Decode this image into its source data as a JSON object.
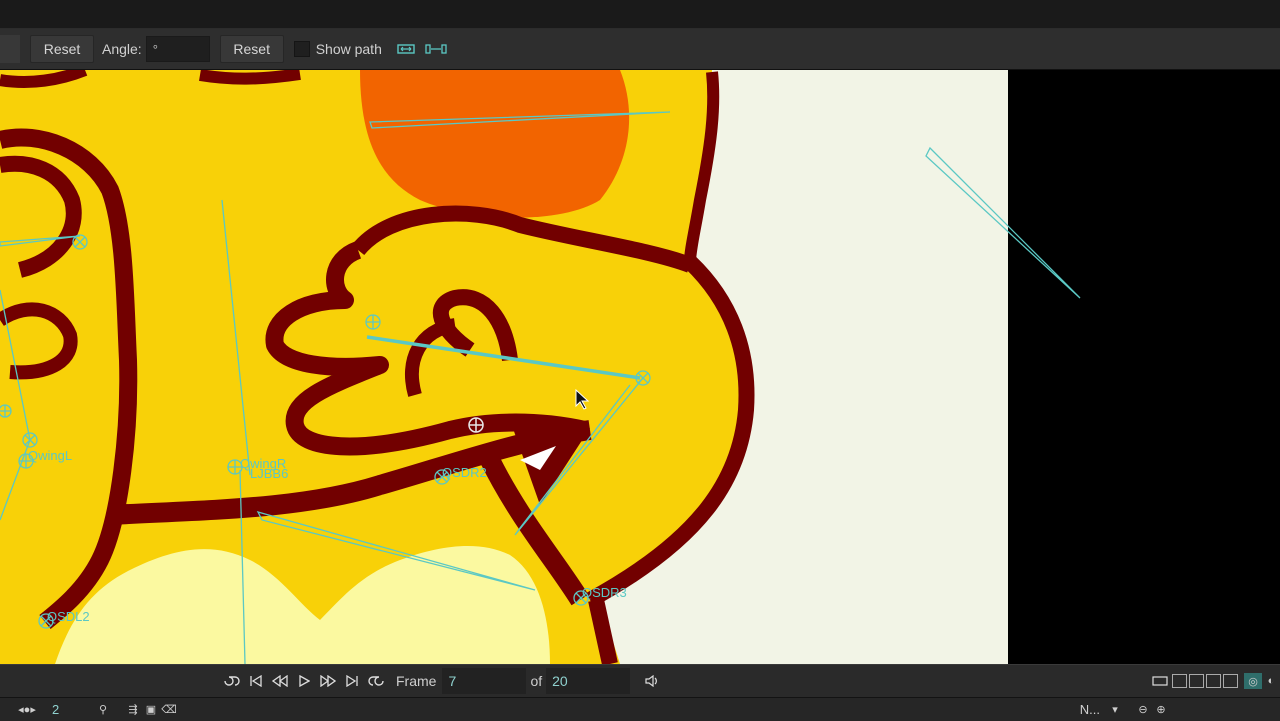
{
  "toolbar": {
    "reset1_label": "Reset",
    "angle_label": "Angle:",
    "angle_value": "°",
    "reset2_label": "Reset",
    "show_path_label": "Show path"
  },
  "canvas": {
    "bone_labels": [
      "QwingL",
      "QwingR",
      "LJBB6",
      "QSDR2",
      "QSDR3",
      "QSDL2"
    ]
  },
  "playback": {
    "frame_label": "Frame",
    "frame_value": "7",
    "of_label": "of",
    "total_frames": "20"
  },
  "bottom": {
    "onion_count": "2",
    "view_mode": "N..."
  },
  "colors": {
    "accent": "#5bc8c4",
    "character_yellow": "#f8d108",
    "outline": "#720000",
    "canvas_bg": "#f2f4e6"
  }
}
